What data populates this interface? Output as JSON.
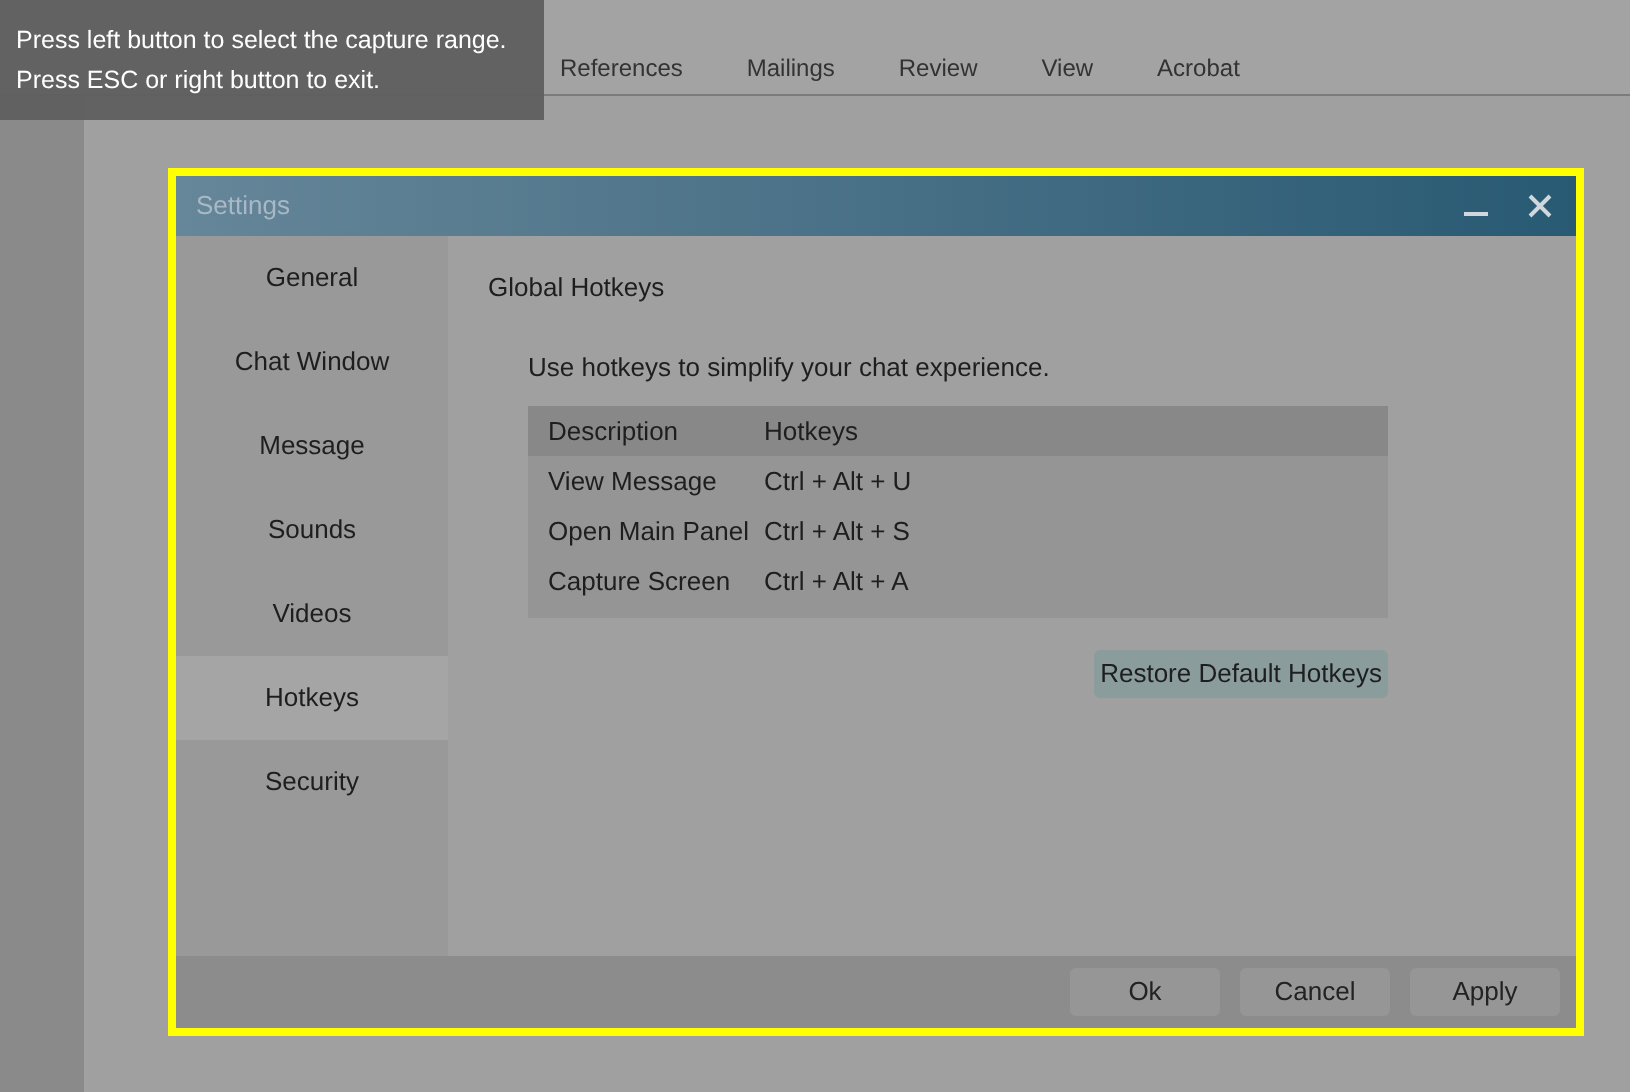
{
  "ribbon_tabs": [
    "References",
    "Mailings",
    "Review",
    "View",
    "Acrobat"
  ],
  "capture_hint": [
    "Press left button to select the capture range.",
    "Press ESC or right button to exit."
  ],
  "dialog": {
    "title": "Settings",
    "sidebar": [
      {
        "label": "General",
        "selected": false
      },
      {
        "label": "Chat Window",
        "selected": false
      },
      {
        "label": "Message",
        "selected": false
      },
      {
        "label": "Sounds",
        "selected": false
      },
      {
        "label": "Videos",
        "selected": false
      },
      {
        "label": "Hotkeys",
        "selected": true
      },
      {
        "label": "Security",
        "selected": false
      }
    ],
    "section_title": "Global Hotkeys",
    "description": "Use hotkeys to simplify your chat experience.",
    "table": {
      "columns": [
        "Description",
        "Hotkeys"
      ],
      "rows": [
        [
          "View Message",
          "Ctrl + Alt + U"
        ],
        [
          "Open Main Panel",
          "Ctrl + Alt + S"
        ],
        [
          "Capture Screen",
          "Ctrl + Alt + A"
        ]
      ]
    },
    "restore_button": "Restore Default Hotkeys",
    "buttons": [
      "Ok",
      "Cancel",
      "Apply"
    ]
  }
}
